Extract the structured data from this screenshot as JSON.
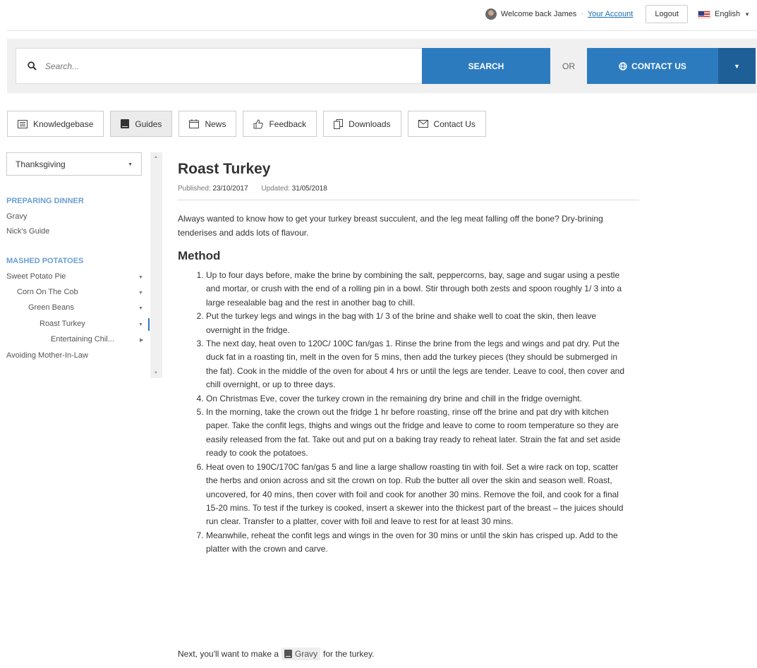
{
  "header": {
    "welcome_text": "Welcome back James",
    "separator": "·",
    "account_link": "Your Account",
    "logout_label": "Logout",
    "language": "English"
  },
  "search": {
    "placeholder": "Search...",
    "button_label": "SEARCH",
    "or_text": "OR",
    "contact_label": "CONTACT US"
  },
  "tabs": [
    {
      "label": "Knowledgebase",
      "icon": "list-icon"
    },
    {
      "label": "Guides",
      "icon": "book-icon",
      "active": true
    },
    {
      "label": "News",
      "icon": "calendar-icon"
    },
    {
      "label": "Feedback",
      "icon": "thumbs-up-icon"
    },
    {
      "label": "Downloads",
      "icon": "copy-icon"
    },
    {
      "label": "Contact Us",
      "icon": "envelope-icon"
    }
  ],
  "sidebar": {
    "selected_guide": "Thanksgiving",
    "section1_heading": "PREPARING DINNER",
    "section1_items": [
      "Gravy",
      "Nick's Guide"
    ],
    "section2_heading": "MASHED POTATOES",
    "tree": [
      {
        "label": "Sweet Potato Pie"
      },
      {
        "label": "Corn On The Cob"
      },
      {
        "label": "Green Beans"
      },
      {
        "label": "Roast Turkey",
        "active": true
      },
      {
        "label": "Entertaining Chil..."
      },
      {
        "label": "Avoiding Mother-In-Law"
      }
    ]
  },
  "article": {
    "title": "Roast Turkey",
    "published_label": "Published:",
    "published_date": "23/10/2017",
    "updated_label": "Updated:",
    "updated_date": "31/05/2018",
    "intro": "Always wanted to know how to get your turkey breast succulent, and the leg meat falling off the bone? Dry-brining tenderises and adds lots of flavour.",
    "method_heading": "Method",
    "steps": [
      "Up to four days before, make the brine by combining the salt, peppercorns, bay, sage and sugar using a pestle and mortar, or crush with the end of a rolling pin in a bowl. Stir through both zests and spoon roughly 1/ 3 into a large resealable bag and the rest in another bag to chill.",
      "Put the turkey legs and wings in the bag with 1/ 3 of the brine and shake well to coat the skin, then leave overnight in the fridge.",
      "The next day, heat oven to 120C/ 100C fan/gas 1. Rinse the brine from the legs and wings and pat dry. Put the duck fat in a roasting tin, melt in the oven for 5 mins, then add the turkey pieces (they should be submerged in the fat). Cook in the middle of the oven for about 4 hrs or until the legs are tender. Leave to cool, then cover and chill overnight, or up to three days.",
      "On Christmas Eve, cover the turkey crown in the remaining dry brine and chill in the fridge overnight.",
      "In the morning, take the crown out the fridge 1 hr before roasting, rinse off the brine and pat dry with kitchen paper. Take the confit legs, thighs and wings out the fridge and leave to come to room temperature so they are easily released from the fat. Take out and put on a baking tray ready to reheat later. Strain the fat and set aside ready to cook the potatoes.",
      "Heat oven to 190C/170C fan/gas 5 and line a large shallow roasting tin with foil. Set a wire rack on top, scatter the herbs and onion across and sit the crown on top. Rub the butter all over the skin and season well. Roast, uncovered, for 40 mins, then cover with foil and cook for another 30 mins. Remove the foil, and cook for a final 15-20 mins. To test if the turkey is cooked, insert a skewer into the thickest part of the breast – the juices should run clear. Transfer to a platter, cover with foil and leave to rest for at least 30 mins.",
      "Meanwhile, reheat the confit legs and wings in the oven for 30 mins or until the skin has crisped up. Add to the platter with the crown and carve."
    ],
    "next_prefix": "Next, you'll want to make a",
    "next_link": "Gravy",
    "next_suffix": "for the turkey."
  },
  "colors": {
    "accent": "#2d7bbf",
    "accent_dark": "#1f5f97",
    "sidebar_heading": "#6b9ed0"
  }
}
